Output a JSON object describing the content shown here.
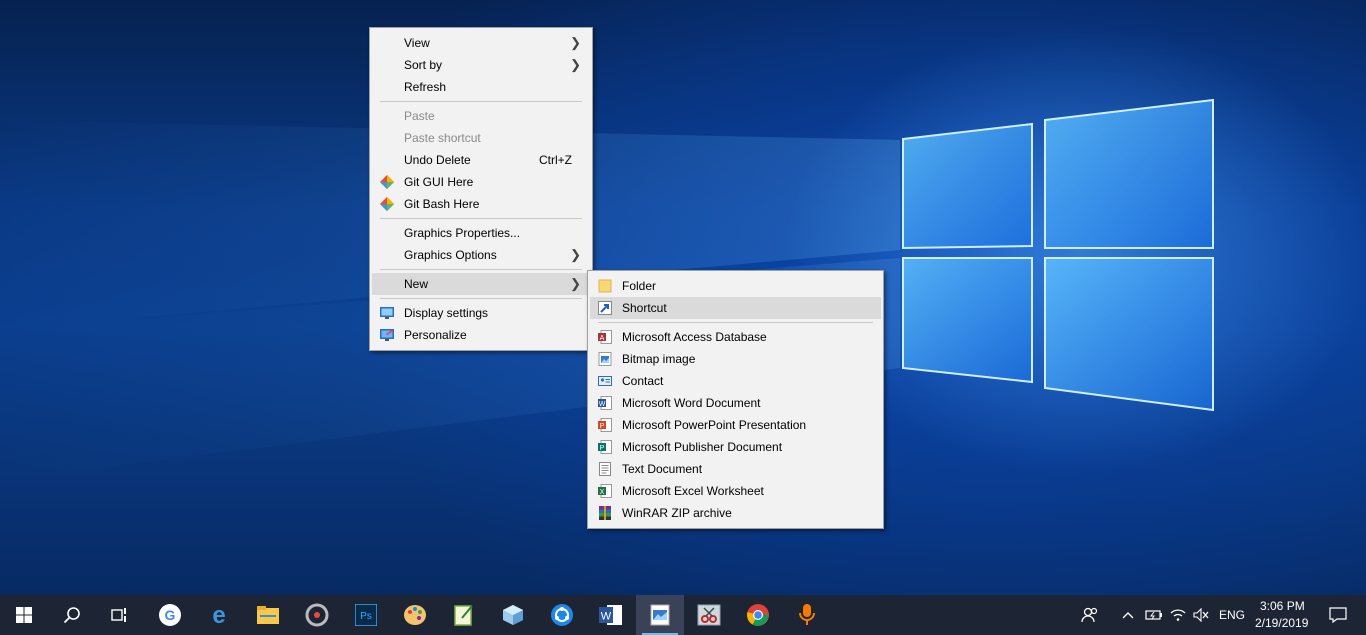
{
  "context_menu": {
    "items": [
      {
        "label": "View",
        "submenu": true
      },
      {
        "label": "Sort by",
        "submenu": true
      },
      {
        "label": "Refresh"
      },
      {
        "label": "Paste",
        "disabled": true
      },
      {
        "label": "Paste shortcut",
        "disabled": true
      },
      {
        "label": "Undo Delete",
        "shortcut": "Ctrl+Z"
      },
      {
        "label": "Git GUI Here",
        "icon": "git-gui-icon"
      },
      {
        "label": "Git Bash Here",
        "icon": "git-bash-icon"
      },
      {
        "label": "Graphics Properties..."
      },
      {
        "label": "Graphics Options",
        "submenu": true
      },
      {
        "label": "New",
        "submenu": true,
        "highlighted": true
      },
      {
        "label": "Display settings",
        "icon": "display-icon"
      },
      {
        "label": "Personalize",
        "icon": "personalize-icon"
      }
    ]
  },
  "new_submenu": {
    "items": [
      {
        "label": "Folder",
        "icon": "folder-icon"
      },
      {
        "label": "Shortcut",
        "icon": "shortcut-icon",
        "highlighted": true
      },
      {
        "label": "Microsoft Access Database",
        "icon": "access-icon"
      },
      {
        "label": "Bitmap image",
        "icon": "bitmap-icon"
      },
      {
        "label": "Contact",
        "icon": "contact-icon"
      },
      {
        "label": "Microsoft Word Document",
        "icon": "word-doc-icon"
      },
      {
        "label": "Microsoft PowerPoint Presentation",
        "icon": "powerpoint-icon"
      },
      {
        "label": "Microsoft Publisher Document",
        "icon": "publisher-icon"
      },
      {
        "label": "Text Document",
        "icon": "text-doc-icon"
      },
      {
        "label": "Microsoft Excel Worksheet",
        "icon": "excel-icon"
      },
      {
        "label": "WinRAR ZIP archive",
        "icon": "winrar-icon"
      }
    ]
  },
  "taskbar": {
    "apps": [
      "start-icon",
      "search-icon",
      "task-view-icon",
      "google-icon",
      "edge-icon",
      "file-explorer-icon",
      "obs-icon",
      "photoshop-icon",
      "paint-icon",
      "notepad-icon",
      "box-app-icon",
      "sync-app-icon",
      "word-icon",
      "image-viewer-icon",
      "snipping-tool-icon",
      "chrome-icon",
      "microphone-icon"
    ],
    "tray": {
      "language": "ENG",
      "time": "3:06 PM",
      "date": "2/19/2019"
    }
  },
  "colors": {
    "accent": "#0078d7",
    "menu_bg": "#f2f2f2",
    "highlight": "#dadada",
    "taskbar": "#1d2433"
  }
}
